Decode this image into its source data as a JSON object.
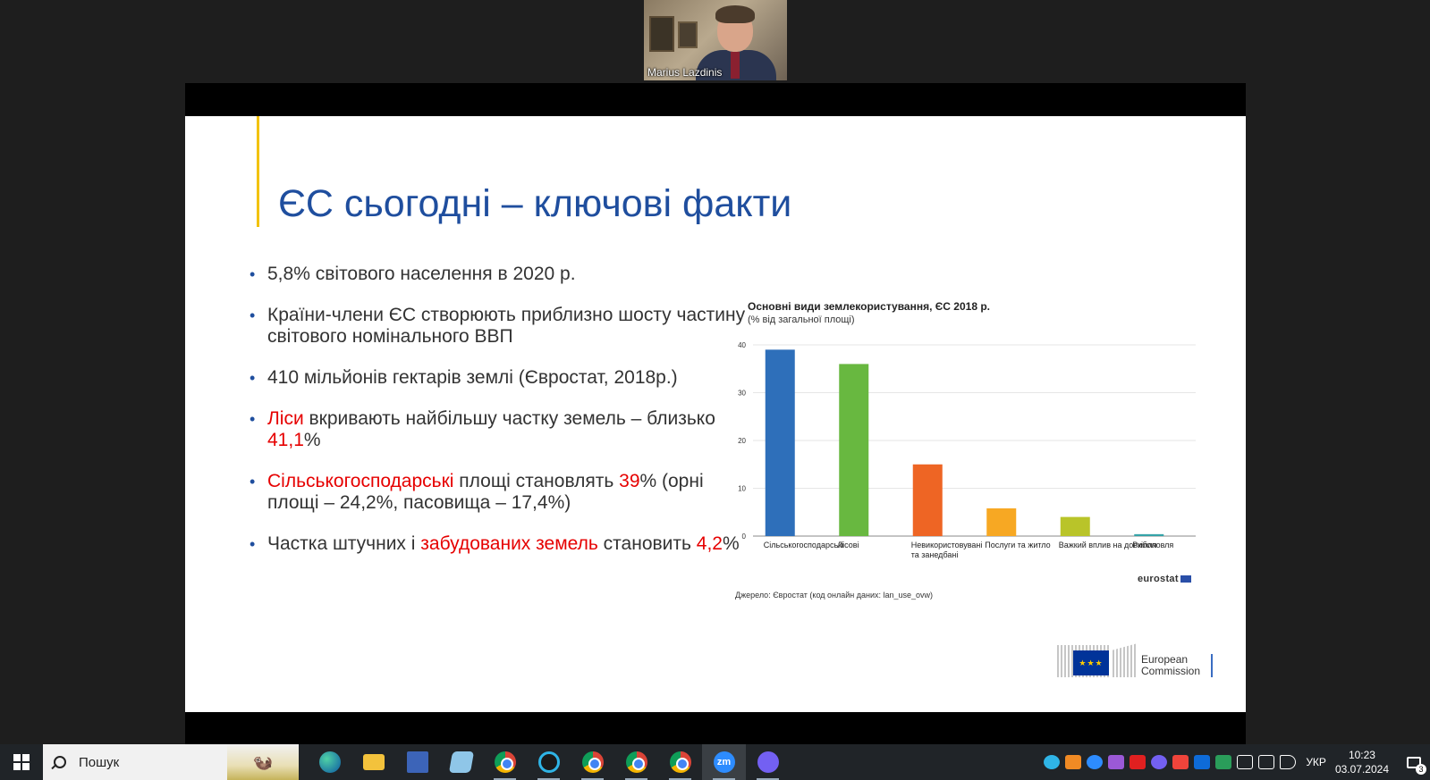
{
  "video": {
    "participant_name": "Marius Lazdinis"
  },
  "slide": {
    "title": "ЄС сьогодні – ключові факти",
    "bullets": [
      {
        "parts": [
          {
            "text": "5,8% світового населення в 2020 р.",
            "red": false
          }
        ]
      },
      {
        "parts": [
          {
            "text": "Країни-члени ЄС створюють приблизно шосту частину світового номінального ВВП",
            "red": false
          }
        ]
      },
      {
        "parts": [
          {
            "text": "410 мільйонів гектарів землі (Євростат, 2018р.)",
            "red": false
          }
        ]
      },
      {
        "parts": [
          {
            "text": "Ліси",
            "red": true
          },
          {
            "text": " вкривають найбільшу частку земель – близько ",
            "red": false
          },
          {
            "text": "41,1",
            "red": true
          },
          {
            "text": "%",
            "red": false
          }
        ]
      },
      {
        "parts": [
          {
            "text": "Сільськогосподарські",
            "red": true
          },
          {
            "text": " площі становлять ",
            "red": false
          },
          {
            "text": "39",
            "red": true
          },
          {
            "text": "% (орні площі –  24,2%, пасовища –  17,4%)",
            "red": false
          }
        ]
      },
      {
        "parts": [
          {
            "text": "Частка штучних і ",
            "red": false
          },
          {
            "text": "забудованих земель",
            "red": true
          },
          {
            "text": " становить ",
            "red": false
          },
          {
            "text": "4,2",
            "red": true
          },
          {
            "text": "%",
            "red": false
          }
        ]
      }
    ],
    "eurostat_label": "eurostat",
    "source": "Джерело: Євростат (код онлайн даних: lan_use_ovw)",
    "ec_logo": {
      "line1": "European",
      "line2": "Commission"
    }
  },
  "chart_data": {
    "type": "bar",
    "title": "Основні види землекористування, ЄС 2018 р.",
    "subtitle": "(% від загальної площі)",
    "categories": [
      "Сільськогосподарські",
      "Лісові",
      "Невикористовувані та занедбані",
      "Послуги та житло",
      "Важкий вплив на довкілля",
      "Риболовля"
    ],
    "category_lines": [
      [
        "Сільськогосподарські"
      ],
      [
        "Лісові"
      ],
      [
        "Невикористовувані",
        "та занедбані"
      ],
      [
        "Послуги та житло"
      ],
      [
        "Важкий вплив на довкілля"
      ],
      [
        "Риболовля"
      ]
    ],
    "values": [
      39,
      36,
      15,
      5.8,
      4.0,
      0.4
    ],
    "colors": [
      "#2e6fba",
      "#68b840",
      "#ee6524",
      "#f7a823",
      "#b9c429",
      "#34a3a8"
    ],
    "ylim": [
      0,
      40
    ],
    "yticks": [
      0,
      10,
      20,
      30,
      40
    ],
    "grid": true
  },
  "taskbar": {
    "search_placeholder": "Пошук",
    "apps": [
      "edge-icon",
      "file-explorer-icon",
      "save-icon",
      "notepad-icon",
      "chrome-icon",
      "webex-icon",
      "chrome-profile-icon",
      "chrome-profile-v-icon",
      "chrome-profile-2-icon",
      "zoom-icon",
      "viber-icon"
    ],
    "zoom_label": "zm",
    "language": "УКР",
    "time": "10:23",
    "date": "03.07.2024",
    "notification_count": "3"
  }
}
